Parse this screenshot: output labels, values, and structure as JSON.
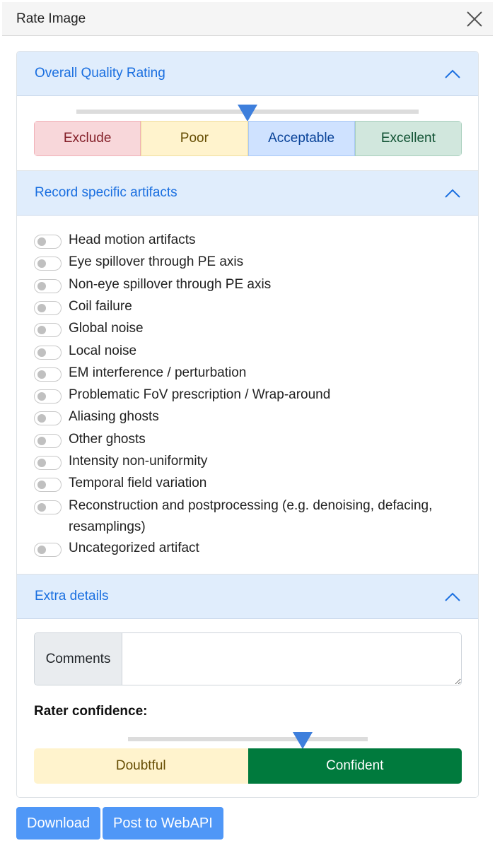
{
  "header": {
    "title": "Rate Image",
    "close_icon": "close-icon"
  },
  "quality": {
    "title": "Overall Quality Rating",
    "slider_value_fraction": 0.5,
    "options": [
      {
        "label": "Exclude",
        "bg": "#f8d7da",
        "fg": "#842029",
        "border": "#f1b0b7"
      },
      {
        "label": "Poor",
        "bg": "#fff3cd",
        "fg": "#664d03",
        "border": "#f1dea0"
      },
      {
        "label": "Acceptable",
        "bg": "#cfe2ff",
        "fg": "#084298",
        "border": "#a9c8f5"
      },
      {
        "label": "Excellent",
        "bg": "#d1e7dd",
        "fg": "#0f5132",
        "border": "#a8cfbd"
      }
    ]
  },
  "artifacts": {
    "title": "Record specific artifacts",
    "items": [
      {
        "label": "Head motion artifacts",
        "checked": false
      },
      {
        "label": "Eye spillover through PE axis",
        "checked": false
      },
      {
        "label": "Non-eye spillover through PE axis",
        "checked": false
      },
      {
        "label": "Coil failure",
        "checked": false
      },
      {
        "label": "Global noise",
        "checked": false
      },
      {
        "label": "Local noise",
        "checked": false
      },
      {
        "label": "EM interference / perturbation",
        "checked": false
      },
      {
        "label": "Problematic FoV prescription / Wrap-around",
        "checked": false
      },
      {
        "label": "Aliasing ghosts",
        "checked": false
      },
      {
        "label": "Other ghosts",
        "checked": false
      },
      {
        "label": "Intensity non-uniformity",
        "checked": false
      },
      {
        "label": "Temporal field variation",
        "checked": false
      },
      {
        "label": "Reconstruction and postprocessing (e.g. denoising, defacing, resamplings)",
        "checked": false
      },
      {
        "label": "Uncategorized artifact",
        "checked": false
      }
    ]
  },
  "extra": {
    "title": "Extra details",
    "comments_label": "Comments",
    "comments_value": "",
    "rater_confidence_label": "Rater confidence:",
    "confidence_slider_fraction": 0.73,
    "confidence_options": [
      {
        "label": "Doubtful",
        "bg": "#fff3cd",
        "fg": "#664d03"
      },
      {
        "label": "Confident",
        "bg": "#007a3d",
        "fg": "#ffffff"
      }
    ]
  },
  "actions": {
    "download": "Download",
    "post": "Post to WebAPI"
  },
  "colors": {
    "accent": "#1a6fe0",
    "header_bg": "#e0edfc",
    "thumb": "#3e7fdc",
    "button": "#4f97f7"
  }
}
